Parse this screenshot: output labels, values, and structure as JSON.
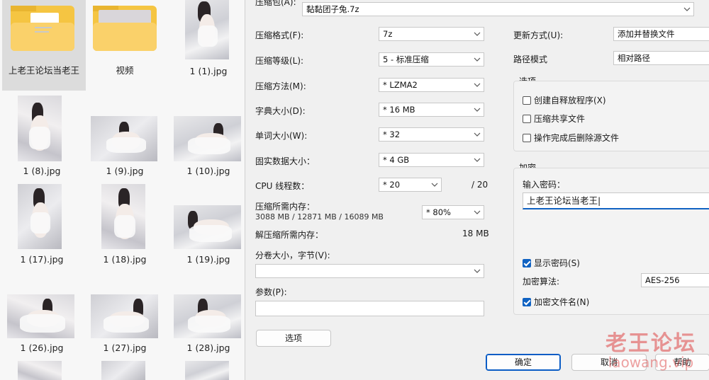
{
  "explorer": {
    "items": [
      {
        "name": "上老王论坛当老王",
        "kind": "folder",
        "selected": true
      },
      {
        "name": "视频",
        "kind": "folder",
        "selected": false
      },
      {
        "name": "1 (1).jpg",
        "kind": "image"
      },
      {
        "name": "1 (8).jpg",
        "kind": "image"
      },
      {
        "name": "1 (9).jpg",
        "kind": "image"
      },
      {
        "name": "1 (10).jpg",
        "kind": "image"
      },
      {
        "name": "1 (17).jpg",
        "kind": "image"
      },
      {
        "name": "1 (18).jpg",
        "kind": "image"
      },
      {
        "name": "1 (19).jpg",
        "kind": "image"
      },
      {
        "name": "1 (26).jpg",
        "kind": "image"
      },
      {
        "name": "1 (27).jpg",
        "kind": "image"
      },
      {
        "name": "1 (28).jpg",
        "kind": "image"
      }
    ]
  },
  "dialog": {
    "archive": {
      "label": "压缩包(A):",
      "value": "黏黏团子兔.7z"
    },
    "format": {
      "label": "压缩格式(F):",
      "value": "7z"
    },
    "level": {
      "label": "压缩等级(L):",
      "value": "5 - 标准压缩"
    },
    "method": {
      "label": "压缩方法(M):",
      "value": "* LZMA2"
    },
    "dict": {
      "label": "字典大小(D):",
      "value": "* 16 MB"
    },
    "word": {
      "label": "单词大小(W):",
      "value": "* 32"
    },
    "solid": {
      "label": "固实数据大小：",
      "value": "* 4 GB"
    },
    "threads": {
      "label": "CPU 线程数：",
      "value": "* 20",
      "max": "/ 20"
    },
    "mem_compress": {
      "label": "压缩所需内存：",
      "detail": "3088 MB / 12871 MB / 16089 MB",
      "value": "* 80%"
    },
    "mem_decompress": {
      "label": "解压缩所需内存：",
      "value": "18 MB"
    },
    "volume": {
      "label": "分卷大小，字节(V):",
      "value": ""
    },
    "params": {
      "label": "参数(P):",
      "value": ""
    },
    "options_button": "选项",
    "update_mode": {
      "label": "更新方式(U):",
      "value": "添加并替换文件"
    },
    "path_mode": {
      "label": "路径模式",
      "value": "相对路径"
    },
    "options_group": {
      "title": "选项",
      "items": [
        {
          "label": "创建自释放程序(X)",
          "checked": false
        },
        {
          "label": "压缩共享文件",
          "checked": false
        },
        {
          "label": "操作完成后删除源文件",
          "checked": false
        }
      ]
    },
    "encryption": {
      "title": "加密",
      "password_label": "输入密码：",
      "password_value": "上老王论坛当老王|",
      "show_password": {
        "label": "显示密码(S)",
        "checked": true
      },
      "method_label": "加密算法:",
      "method_value": "AES-256",
      "encrypt_names": {
        "label": "加密文件名(N)",
        "checked": true
      }
    },
    "buttons": {
      "ok": "确定",
      "cancel": "取消",
      "help": "帮助"
    }
  },
  "watermark": {
    "line1": "老王论坛",
    "line2": "laowang.vip"
  },
  "colors": {
    "accent": "#0f62c2",
    "folder": "#f5c542",
    "watermark": "#de4646"
  }
}
